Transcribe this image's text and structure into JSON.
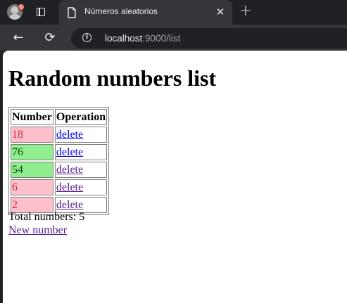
{
  "browser": {
    "tab_title": "Números aleatorios",
    "close_glyph": "✕",
    "new_tab_glyph": "+",
    "back_glyph": "←",
    "reload_glyph": "⟳",
    "info_glyph": "i",
    "url_host": "localhost",
    "url_path": ":9000/list"
  },
  "page": {
    "heading": "Random numbers list",
    "table": {
      "headers": [
        "Number",
        "Operation"
      ],
      "rows": [
        {
          "number": "18",
          "operation": "delete",
          "highlight": "pink"
        },
        {
          "number": "76",
          "operation": "delete",
          "highlight": "green"
        },
        {
          "number": "54",
          "operation": "delete",
          "highlight": "green"
        },
        {
          "number": "6",
          "operation": "delete",
          "highlight": "pink"
        },
        {
          "number": "2",
          "operation": "delete",
          "highlight": "pink"
        }
      ]
    },
    "total_text": "Total numbers: 5",
    "new_number_link": "New number"
  },
  "colors": {
    "pink": "#ffc0cb",
    "green": "#90ee90",
    "link": "#0000ee",
    "visited_link": "#551a8b"
  }
}
